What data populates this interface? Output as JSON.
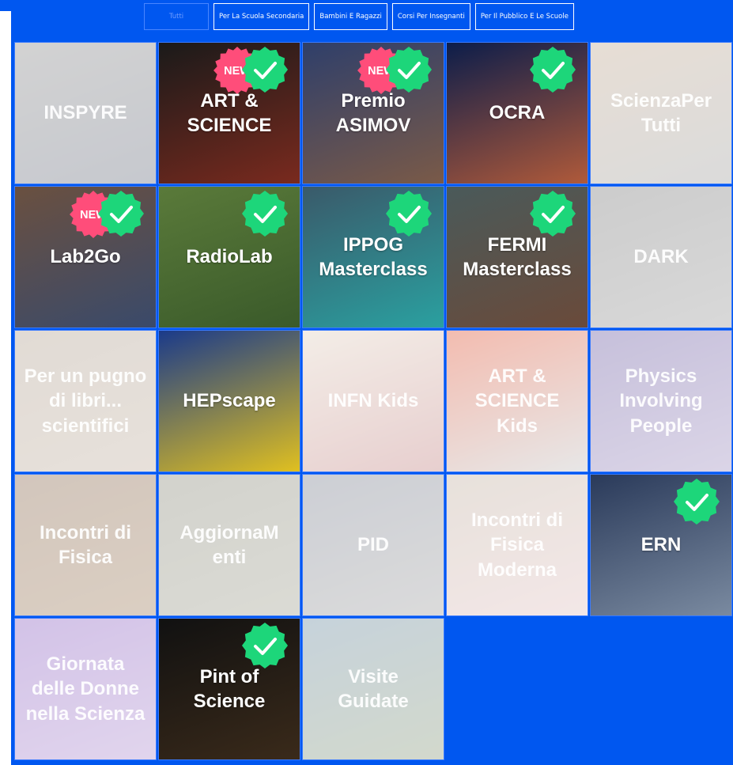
{
  "filters": [
    {
      "label": "Tutti",
      "active": true
    },
    {
      "label": "Per La Scuola Secondaria",
      "active": false
    },
    {
      "label": "Bambini E Ragazzi",
      "active": false
    },
    {
      "label": "Corsi Per Insegnanti",
      "active": false
    },
    {
      "label": "Per Il Pubblico E Le Scuole",
      "active": false
    }
  ],
  "badges": {
    "new_label": "NEW"
  },
  "colors": {
    "brand_blue": "#0057f0",
    "check_green": "#1dd67a",
    "new_pink": "#ff4d7a"
  },
  "tiles": [
    {
      "title": "INSPYRE",
      "active": false,
      "check": false,
      "new": false,
      "colors": [
        "#8a8a8a",
        "#6a7080"
      ]
    },
    {
      "title": "ART & SCIENCE",
      "active": true,
      "check": true,
      "new": true,
      "colors": [
        "#1a1a1a",
        "#7a2a1e"
      ]
    },
    {
      "title": "Premio ASIMOV",
      "active": true,
      "check": true,
      "new": true,
      "colors": [
        "#2f3f6a",
        "#7a5a48"
      ]
    },
    {
      "title": "OCRA",
      "active": true,
      "check": true,
      "new": false,
      "colors": [
        "#0c1d4a",
        "#b05a3a"
      ]
    },
    {
      "title": "ScienzaPer Tutti",
      "active": false,
      "check": false,
      "new": false,
      "colors": [
        "#c0a890",
        "#a0a0a0"
      ]
    },
    {
      "title": "Lab2Go",
      "active": true,
      "check": true,
      "new": true,
      "colors": [
        "#6a5040",
        "#3a4a6a"
      ]
    },
    {
      "title": "RadioLab",
      "active": true,
      "check": true,
      "new": false,
      "colors": [
        "#5a7a3a",
        "#3a5a2a"
      ]
    },
    {
      "title": "IPPOG Masterclass",
      "active": true,
      "check": true,
      "new": false,
      "colors": [
        "#3a5a6a",
        "#2aa0a0"
      ]
    },
    {
      "title": "FERMI Masterclass",
      "active": true,
      "check": true,
      "new": false,
      "colors": [
        "#4a5a5a",
        "#6a4a3a"
      ]
    },
    {
      "title": "DARK",
      "active": false,
      "check": false,
      "new": false,
      "colors": [
        "#7a7a7a",
        "#9a9a9a"
      ]
    },
    {
      "title": "Per un pugno di libri... scientifici",
      "active": false,
      "check": false,
      "new": false,
      "colors": [
        "#b0a090",
        "#c0b0a0"
      ]
    },
    {
      "title": "HEPscape",
      "active": true,
      "check": false,
      "new": false,
      "colors": [
        "#1a3a8a",
        "#e0c020"
      ]
    },
    {
      "title": "INFN Kids",
      "active": false,
      "check": false,
      "new": false,
      "colors": [
        "#e0d0c0",
        "#c08080"
      ]
    },
    {
      "title": "ART & SCIENCE Kids",
      "active": false,
      "check": false,
      "new": false,
      "colors": [
        "#e05030",
        "#c0c0c0"
      ]
    },
    {
      "title": "Physics Involving People",
      "active": false,
      "check": false,
      "new": false,
      "colors": [
        "#6a5aa0",
        "#a090c0"
      ]
    },
    {
      "title": "Incontri di Fisica",
      "active": false,
      "check": false,
      "new": false,
      "colors": [
        "#8a6a50",
        "#a08060"
      ]
    },
    {
      "title": "AggiornaM enti",
      "active": false,
      "check": false,
      "new": false,
      "colors": [
        "#8a8a7a",
        "#a0a090"
      ]
    },
    {
      "title": "PID",
      "active": false,
      "check": false,
      "new": false,
      "colors": [
        "#7a8090",
        "#a0a0a0"
      ]
    },
    {
      "title": "Incontri di Fisica Moderna",
      "active": false,
      "check": false,
      "new": false,
      "colors": [
        "#c0b0a0",
        "#e0c0c0"
      ]
    },
    {
      "title": "ERN",
      "active": true,
      "check": true,
      "new": false,
      "colors": [
        "#2a3a5a",
        "#7a8aa0"
      ]
    },
    {
      "title": "Giornata delle Donne nella Scienza",
      "active": false,
      "check": false,
      "new": false,
      "colors": [
        "#8a60c0",
        "#b090d0"
      ]
    },
    {
      "title": "Pint of Science",
      "active": true,
      "check": true,
      "new": false,
      "colors": [
        "#111111",
        "#3a2a1a"
      ]
    },
    {
      "title": "Visite Guidate",
      "active": false,
      "check": false,
      "new": false,
      "colors": [
        "#6a8aa0",
        "#8a9a7a"
      ]
    }
  ]
}
